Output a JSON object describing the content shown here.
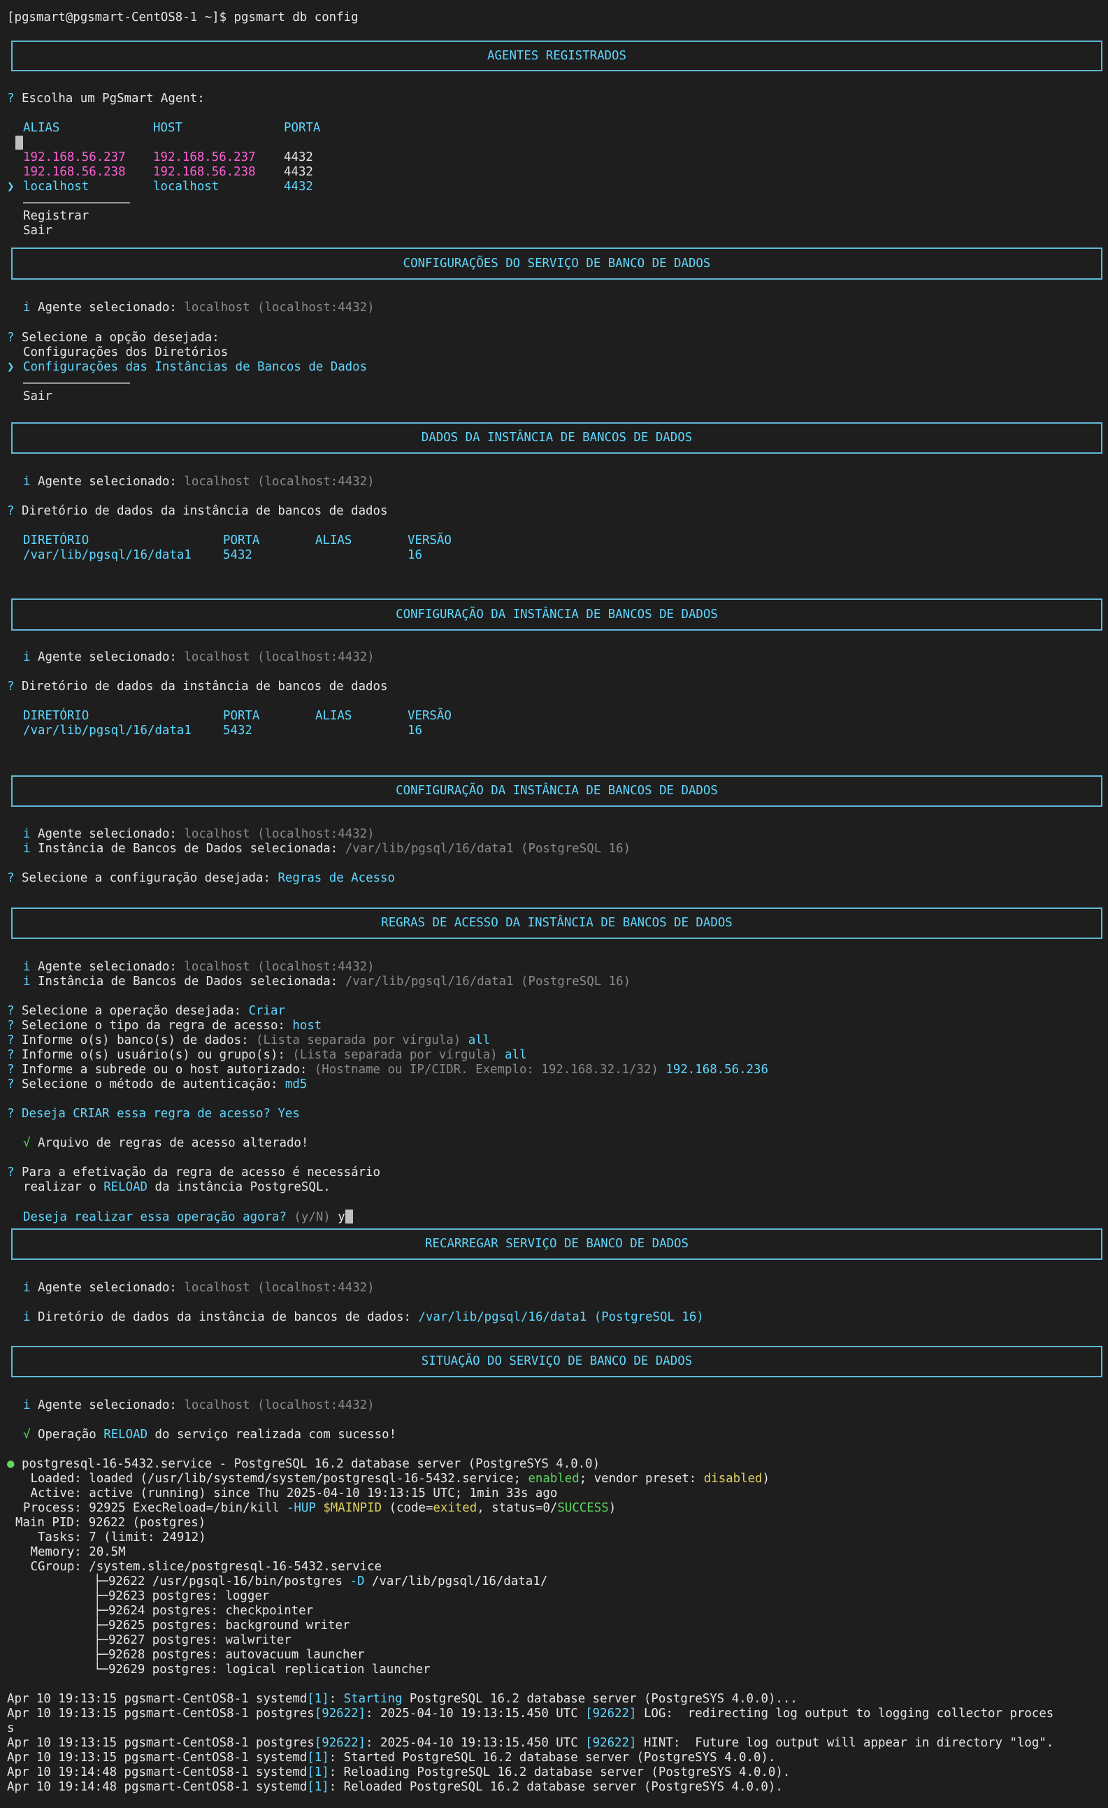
{
  "prompt": "[pgsmart@pgsmart-CentOS8-1 ~]$ pgsmart db config",
  "sec1": {
    "title": "AGENTES REGISTRADOS",
    "question": "Escolha um PgSmart Agent:",
    "headers": [
      "ALIAS",
      "HOST",
      "PORTA"
    ],
    "rows": [
      {
        "alias": "192.168.56.237",
        "host": "192.168.56.237",
        "port": "4432"
      },
      {
        "alias": "192.168.56.238",
        "host": "192.168.56.238",
        "port": "4432"
      },
      {
        "alias": "localhost",
        "host": "localhost",
        "port": "4432"
      }
    ],
    "register": "Registrar",
    "exit": "Sair"
  },
  "sec2": {
    "title": "CONFIGURAÇÕES DO SERVIÇO DE BANCO DE DADOS",
    "agent_label": "Agente selecionado:",
    "agent_value": "localhost (localhost:4432)",
    "question": "Selecione a opção desejada:",
    "opt1": "Configurações dos Diretórios",
    "opt2": "Configurações das Instâncias de Bancos de Dados",
    "exit": "Sair"
  },
  "sec3": {
    "title": "DADOS DA INSTÂNCIA DE BANCOS DE DADOS",
    "question": "Diretório de dados da instância de bancos de dados",
    "headers": [
      "DIRETÓRIO",
      "PORTA",
      "ALIAS",
      "VERSÃO"
    ],
    "row": {
      "dir": "/var/lib/pgsql/16/data1",
      "port": "5432",
      "alias": "",
      "version": "16"
    }
  },
  "sec4": {
    "title": "CONFIGURAÇÃO DA INSTÂNCIA DE BANCOS DE DADOS"
  },
  "sec5": {
    "instance_label": "Instância de Bancos de Dados selecionada:",
    "instance_value": "/var/lib/pgsql/16/data1 (PostgreSQL 16)",
    "question": "Selecione a configuração desejada:",
    "answer": "Regras de Acesso"
  },
  "sec6": {
    "title": "REGRAS DE ACESSO DA INSTÂNCIA DE BANCOS DE DADOS",
    "q_op": "Selecione a operação desejada:",
    "a_op": "Criar",
    "q_type": "Selecione o tipo da regra de acesso:",
    "a_type": "host",
    "q_db": "Informe o(s) banco(s) de dados:",
    "h_db": "(Lista separada por vírgula)",
    "a_db": "all",
    "q_user": "Informe o(s) usuário(s) ou grupo(s):",
    "h_user": "(Lista separada por vírgula)",
    "a_user": "all",
    "q_net": "Informe a subrede ou o host autorizado:",
    "h_net": "(Hostname ou IP/CIDR. Exemplo: 192.168.32.1/32)",
    "a_net": "192.168.56.236",
    "q_auth": "Selecione o método de autenticação:",
    "a_auth": "md5",
    "confirm_q": "Deseja CRIAR essa regra de acesso?",
    "confirm_a": "Yes",
    "success": "Arquivo de regras de acesso alterado!",
    "reload_1": "Para a efetivação da regra de acesso é necessário",
    "reload_2a": "realizar o",
    "reload_2b": "RELOAD",
    "reload_2c": "da instância PostgreSQL.",
    "now_q": "Deseja realizar essa operação agora?",
    "now_hint": "(y/N)",
    "now_a": "y"
  },
  "sec7": {
    "title": "RECARREGAR SERVIÇO DE BANCO DE DADOS",
    "dir_label": "Diretório de dados da instância de bancos de dados:",
    "dir_value": "/var/lib/pgsql/16/data1 (PostgreSQL 16)"
  },
  "sec8": {
    "title": "SITUAÇÃO DO SERVIÇO DE BANCO DE DADOS",
    "ok_a": "Operação",
    "ok_b": "RELOAD",
    "ok_c": "do serviço realizada com sucesso!"
  },
  "status": {
    "head": "postgresql-16-5432.service - PostgreSQL 16.2 database server (PostgreSYS 4.0.0)",
    "loaded_a": " Loaded: loaded (/usr/lib/systemd/system/postgresql-16-5432.service;",
    "loaded_b": "enabled",
    "loaded_c": "; vendor preset:",
    "loaded_d": "disabled",
    "loaded_e": ")",
    "active": " Active: active (running) since Thu 2025-04-10 19:13:15 UTC; 1min 33s ago",
    "process_a": "Process: 92925 ExecReload=/bin/kill",
    "process_b": "-HUP",
    "process_c": "$MAINPID",
    "process_d": "(code=",
    "process_e": "exited",
    "process_f": ", status=0/",
    "process_g": "SUCCESS",
    "process_h": ")",
    "mainpid": "Main PID: 92622 (postgres)",
    "tasks": "  Tasks: 7 (limit: 24912)",
    "memory": " Memory: 20.5M",
    "cgroup": " CGroup: /system.slice/postgresql-16-5432.service",
    "tree": [
      "├─92622 /usr/pgsql-16/bin/postgres",
      "├─92623 postgres: logger",
      "├─92624 postgres: checkpointer",
      "├─92625 postgres: background writer",
      "├─92627 postgres: walwriter",
      "├─92628 postgres: autovacuum launcher",
      "└─92629 postgres: logical replication launcher"
    ],
    "tree_opt": "-D",
    "tree_tail": "/var/lib/pgsql/16/data1/"
  },
  "log": {
    "l1a": "Apr 10 19:13:15 pgsmart-CentOS8-1 systemd",
    "l1b": "[1]",
    "l1c": ":",
    "l1d": "Starting",
    "l1e": "PostgreSQL 16.2 database server (PostgreSYS 4.0.0)...",
    "l2a": "Apr 10 19:13:15 pgsmart-CentOS8-1 postgres",
    "l2b": "[92622]",
    "l2c": ": 2025-04-10 19:13:15.450 UTC",
    "l2d": "[92622]",
    "l2e": "LOG:  redirecting log output to logging collector proces",
    "l2wrap": "s",
    "l3a": "Apr 10 19:13:15 pgsmart-CentOS8-1 postgres",
    "l3b": "[92622]",
    "l3c": ": 2025-04-10 19:13:15.450 UTC",
    "l3d": "[92622]",
    "l3e": "HINT:  Future log output will appear in directory \"log\".",
    "l4a": "Apr 10 19:13:15 pgsmart-CentOS8-1 systemd",
    "l4b": "[1]",
    "l4c": ": Started PostgreSQL 16.2 database server (PostgreSYS 4.0.0).",
    "l5a": "Apr 10 19:14:48 pgsmart-CentOS8-1 systemd",
    "l5b": "[1]",
    "l5c": ": Reloading PostgreSQL 16.2 database server (PostgreSYS 4.0.0).",
    "l6a": "Apr 10 19:14:48 pgsmart-CentOS8-1 systemd",
    "l6b": "[1]",
    "l6c": ": Reloaded PostgreSQL 16.2 database server (PostgreSYS 4.0.0)."
  },
  "glyphs": {
    "q": "?",
    "info": "i",
    "check": "√",
    "pointer": "❯",
    "dot": "●"
  }
}
